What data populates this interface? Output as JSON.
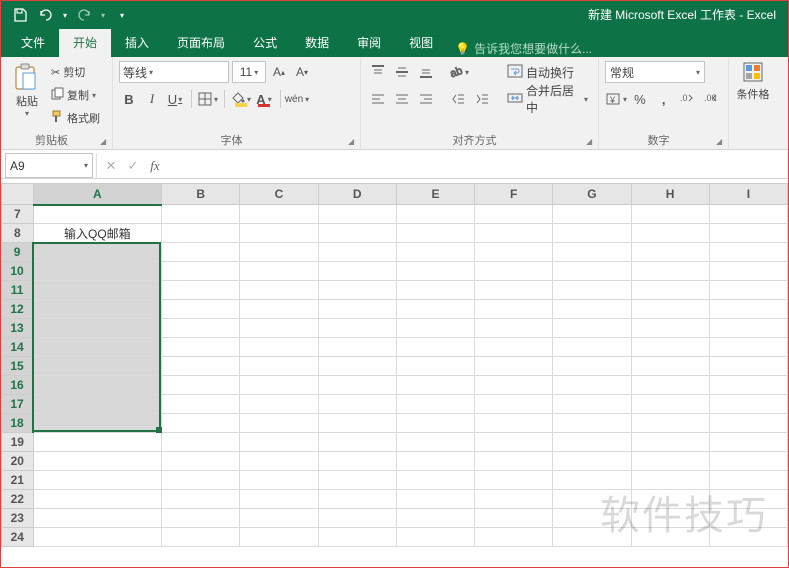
{
  "title": "新建 Microsoft Excel 工作表 - Excel",
  "menu": {
    "file": "文件",
    "home": "开始",
    "insert": "插入",
    "layout": "页面布局",
    "formulas": "公式",
    "data": "数据",
    "review": "审阅",
    "view": "视图",
    "tellme": "告诉我您想要做什么..."
  },
  "ribbon": {
    "clipboard": {
      "paste": "粘贴",
      "cut": "剪切",
      "copy": "复制",
      "brush": "格式刷",
      "label": "剪贴板"
    },
    "font": {
      "name": "等线",
      "size": "11",
      "wen": "wén",
      "label": "字体"
    },
    "align": {
      "wrap": "自动换行",
      "merge": "合并后居中",
      "label": "对齐方式"
    },
    "number": {
      "format": "常规",
      "label": "数字"
    },
    "styles": {
      "cond": "条件格"
    }
  },
  "namebox": "A9",
  "columns": [
    "A",
    "B",
    "C",
    "D",
    "E",
    "F",
    "G",
    "H",
    "I"
  ],
  "rows_start": 7,
  "rows_end": 24,
  "cell_A8": "输入QQ邮箱",
  "selected_rows": [
    9,
    10,
    11,
    12,
    13,
    14,
    15,
    16,
    17,
    18
  ],
  "watermark": "软件技巧"
}
